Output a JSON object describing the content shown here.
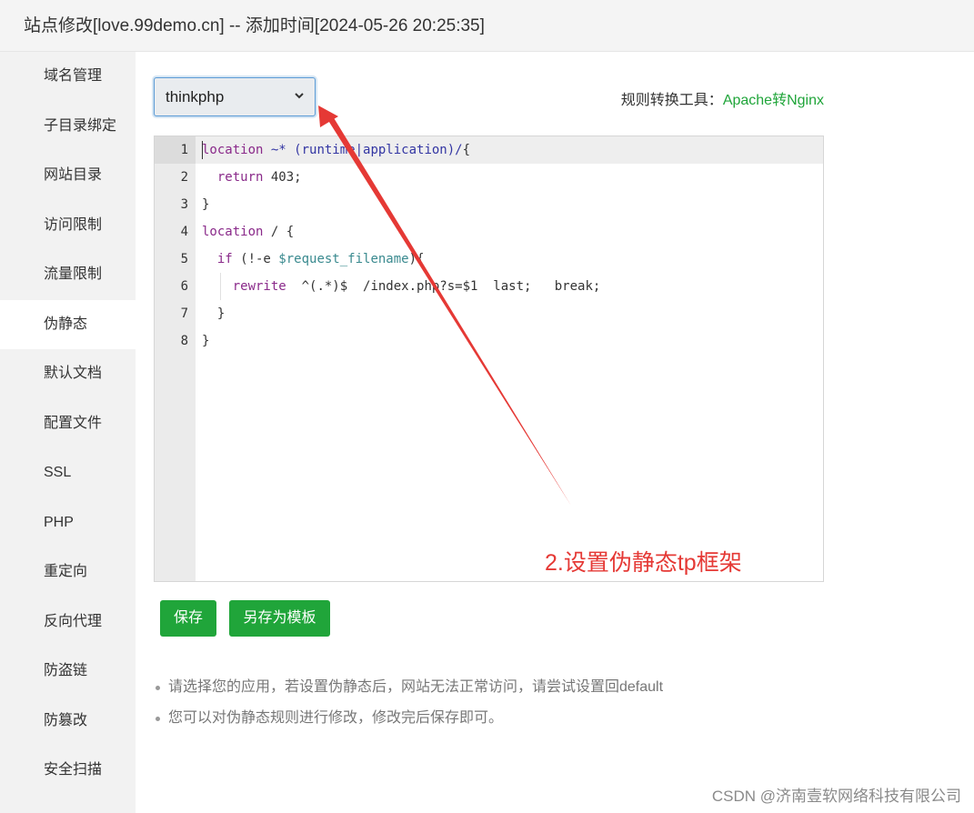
{
  "window": {
    "title": "站点修改[love.99demo.cn] -- 添加时间[2024-05-26 20:25:35]"
  },
  "sidebar": {
    "items": [
      {
        "label": "域名管理"
      },
      {
        "label": "子目录绑定"
      },
      {
        "label": "网站目录"
      },
      {
        "label": "访问限制"
      },
      {
        "label": "流量限制"
      },
      {
        "label": "伪静态",
        "active": true
      },
      {
        "label": "默认文档"
      },
      {
        "label": "配置文件"
      },
      {
        "label": "SSL"
      },
      {
        "label": "PHP"
      },
      {
        "label": "重定向"
      },
      {
        "label": "反向代理"
      },
      {
        "label": "防盗链"
      },
      {
        "label": "防篡改"
      },
      {
        "label": "安全扫描"
      }
    ]
  },
  "rewrite": {
    "template_select": {
      "value": "thinkphp",
      "icon": "chevron-down-icon"
    },
    "convert_tool": {
      "label": "规则转换工具：",
      "link": "Apache转Nginx"
    },
    "editor": {
      "line_numbers": [
        "1",
        "2",
        "3",
        "4",
        "5",
        "6",
        "7",
        "8"
      ],
      "lines": [
        "location ~* (runtime|application)/{",
        "  return 403;",
        "}",
        "location / {",
        "  if (!-e $request_filename){",
        "    rewrite  ^(.*)$  /index.php?s=$1  last;   break;",
        "  }",
        "}"
      ]
    },
    "buttons": {
      "save": "保存",
      "save_as_template": "另存为模板"
    },
    "tips": [
      "请选择您的应用，若设置伪静态后，网站无法正常访问，请尝试设置回default",
      "您可以对伪静态规则进行修改，修改完后保存即可。"
    ]
  },
  "annotation": {
    "text": "2.设置伪静态tp框架",
    "color": "#e53935"
  },
  "watermark": "CSDN @济南壹软网络科技有限公司",
  "colors": {
    "accent": "#20a53a",
    "annotation": "#e53935"
  }
}
